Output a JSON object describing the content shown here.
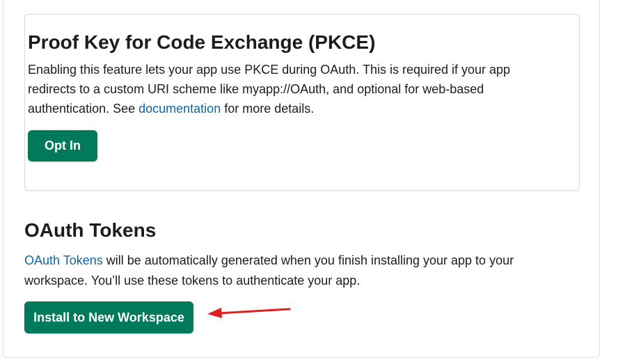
{
  "pkce": {
    "title": "Proof Key for Code Exchange (PKCE)",
    "description_before_link": "Enabling this feature lets your app use PKCE during OAuth. This is required if your app redirects to a custom URI scheme like myapp://OAuth, and optional for web-based authentication. See ",
    "link_text": "documentation",
    "description_after_link": " for more details.",
    "button_label": "Opt In"
  },
  "oauth_tokens": {
    "title": "OAuth Tokens",
    "link_text": "OAuth Tokens",
    "description": " will be automatically generated when you finish installing your app to your workspace. You’ll use these tokens to authenticate your app.",
    "button_label": "Install to New Workspace"
  },
  "colors": {
    "button_green": "#007a5a",
    "link_blue": "#1264a3",
    "annotation_red": "#e01e1e"
  },
  "annotation": {
    "icon": "red-arrow-left-icon"
  }
}
